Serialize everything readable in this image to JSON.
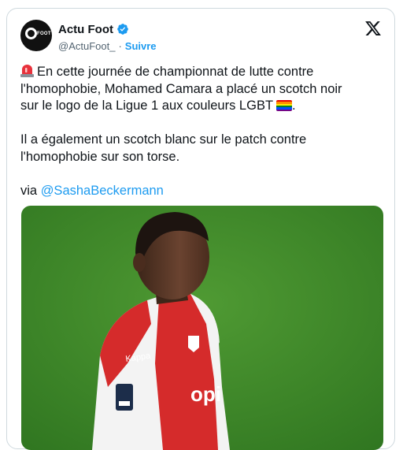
{
  "author": {
    "display_name": "Actu Foot",
    "handle": "@ActuFoot_",
    "separator": "·",
    "follow_label": "Suivre",
    "avatar_text": "FOOT"
  },
  "tweet": {
    "line1": "En cette journée de championnat de lutte contre",
    "line2": "l'homophobie, Mohamed Camara a placé un scotch noir",
    "line3": "sur le logo de la Ligue 1 aux couleurs LGBT",
    "line3_end": ".",
    "line4": "Il a également un scotch blanc sur le patch contre",
    "line5": "l'homophobie sur son torse.",
    "via_prefix": "via ",
    "mention": "@SashaBeckermann"
  },
  "media": {
    "jersey_brand": "Kappa",
    "jersey_sponsor": "opi"
  },
  "colors": {
    "link": "#1d9bf0",
    "text": "#0f1419",
    "secondary": "#536471",
    "verified": "#1d9bf0",
    "pitch": "#3f8a2a",
    "jersey_red": "#d52b2b"
  },
  "icons": [
    "verified-badge-icon",
    "x-logo-icon",
    "siren-emoji-icon",
    "rainbow-flag-emoji-icon"
  ]
}
